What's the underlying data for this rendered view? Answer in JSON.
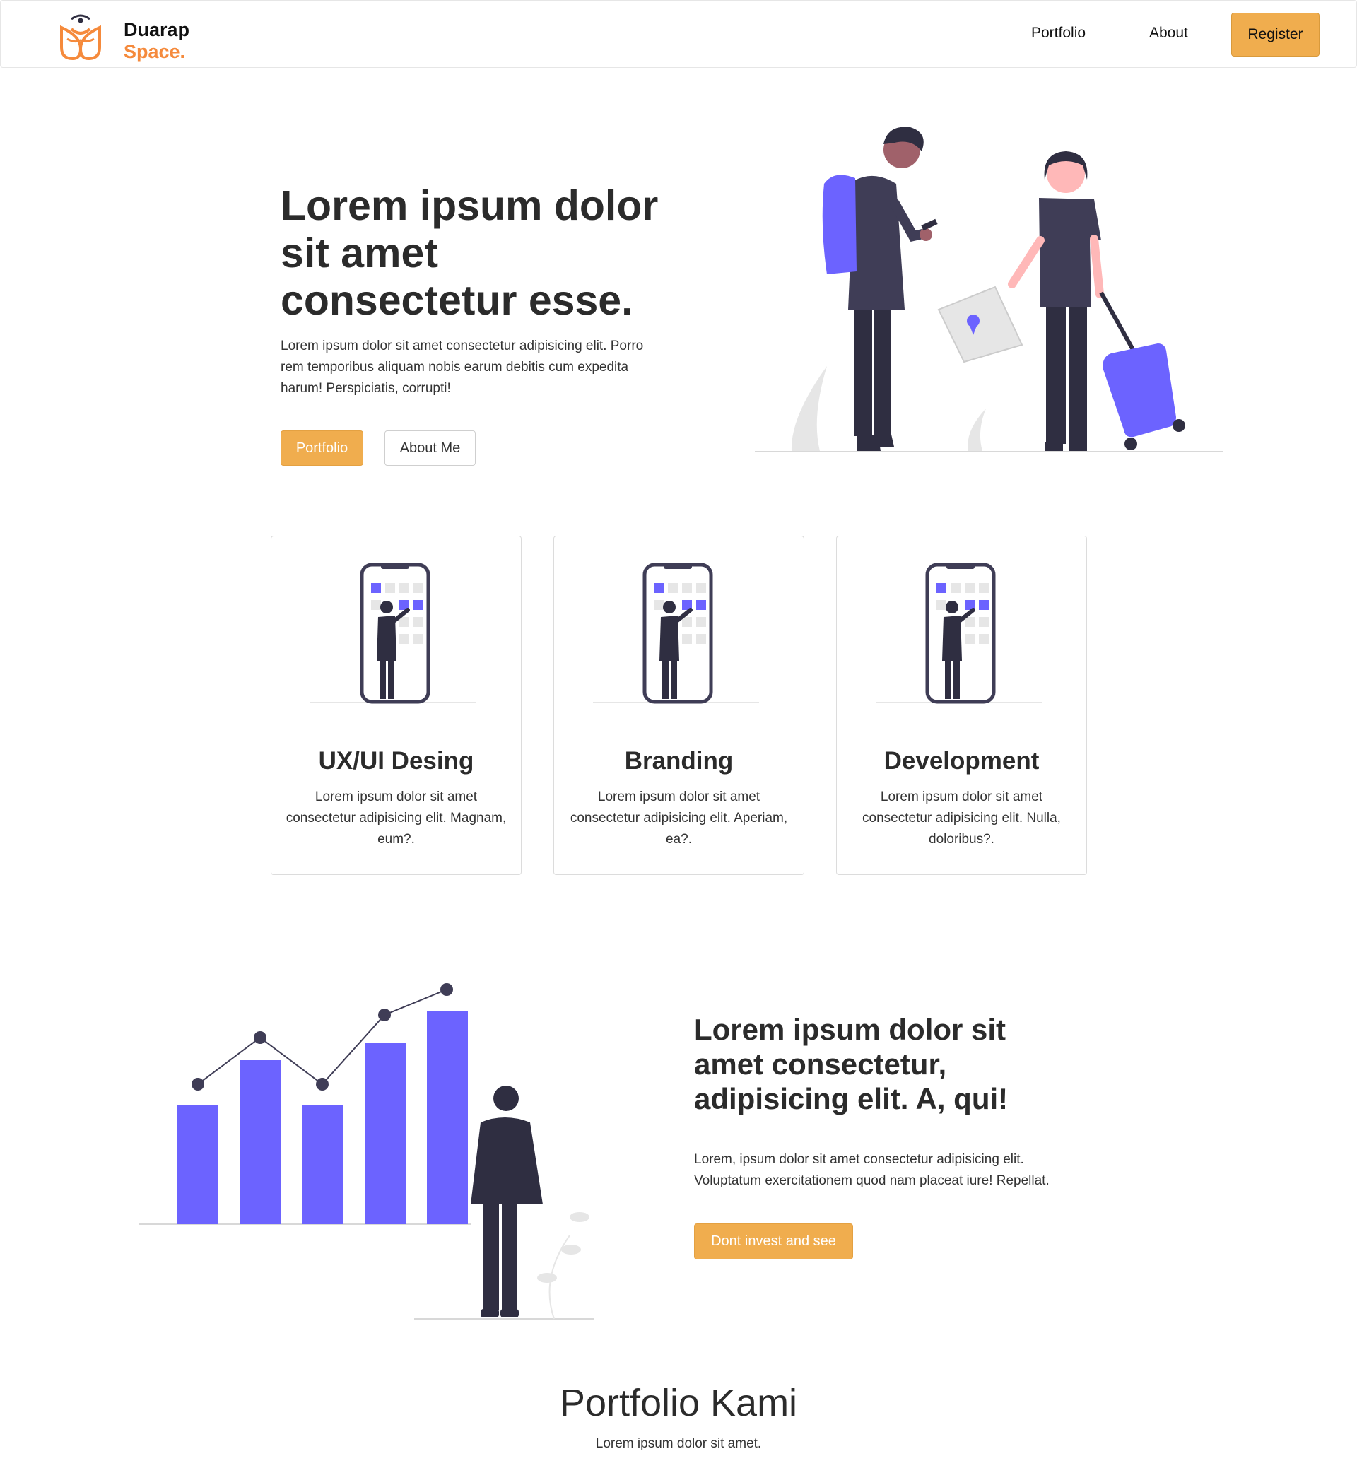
{
  "nav": {
    "brand_line1": "Duarap",
    "brand_line2": "Space.",
    "links": [
      "Portfolio",
      "About"
    ],
    "register_label": "Register"
  },
  "hero": {
    "title": "Lorem ipsum dolor sit amet consectetur esse.",
    "text": "Lorem ipsum dolor sit amet consectetur adipisicing elit. Porro rem temporibus aliquam nobis earum debitis cum expedita harum! Perspiciatis, corrupti!",
    "primary_button": "Portfolio",
    "secondary_button": "About Me"
  },
  "services": [
    {
      "title": "UX/UI Desing",
      "text": "Lorem ipsum dolor sit amet consectetur adipisicing elit. Magnam, eum?."
    },
    {
      "title": "Branding",
      "text": "Lorem ipsum dolor sit amet consectetur adipisicing elit. Aperiam, ea?."
    },
    {
      "title": "Development",
      "text": "Lorem ipsum dolor sit amet consectetur adipisicing elit. Nulla, doloribus?."
    }
  ],
  "feature": {
    "title": "Lorem ipsum dolor sit amet consectetur, adipisicing elit. A, qui!",
    "text": "Lorem, ipsum dolor sit amet consectetur adipisicing elit. Voluptatum exercitationem quod nam placeat iure! Repellat.",
    "button": "Dont invest and see"
  },
  "portfolio": {
    "title": "Portfolio Kami",
    "subtitle": "Lorem ipsum dolor sit amet."
  },
  "colors": {
    "accent": "#f0ad4e",
    "brand_orange": "#f58a3c",
    "illustration_purple": "#6c63ff",
    "illustration_dark": "#2f2e41"
  },
  "icons": [
    "brand-logo-icon"
  ]
}
